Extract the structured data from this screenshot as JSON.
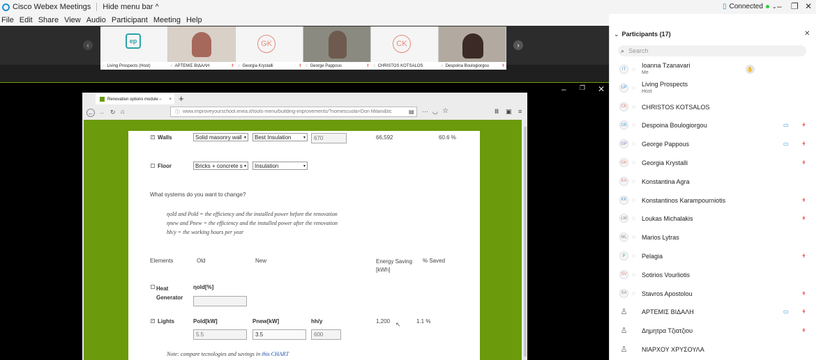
{
  "app": {
    "title": "Cisco Webex Meetings",
    "hide_menu": "Hide menu bar ^",
    "status": "Connected"
  },
  "menu": [
    "File",
    "Edit",
    "Share",
    "View",
    "Audio",
    "Participant",
    "Meeting",
    "Help"
  ],
  "tiles": [
    {
      "label": "Living Prospects (Host)",
      "kind": "logo",
      "logo": "ep"
    },
    {
      "label": "ΑΡΤΕΜΙΣ ΒΙΔΑΛΗ",
      "kind": "video"
    },
    {
      "label": "Georgia Krystalli",
      "kind": "initials",
      "initials": "GK"
    },
    {
      "label": "George Pappous",
      "kind": "video"
    },
    {
      "label": "CHRISTOS KOTSALOS",
      "kind": "initials",
      "initials": "CK"
    },
    {
      "label": "Despoina Boulogiorgou",
      "kind": "video"
    }
  ],
  "browser": {
    "tab": "Renovation options module –",
    "url": "www.improveyourschool.enea.it/tools-menu/building-improvements/?nomescuola=Don Milani&tic"
  },
  "doc": {
    "walls_label": "Walls",
    "walls_sel1": "Solid masonry wall",
    "walls_sel2": "Best Insulation",
    "walls_input": "670",
    "walls_saving": "66,592",
    "walls_pct": "60.6 %",
    "floor_label": "Floor",
    "floor_sel1": "Bricks + concrete s",
    "floor_sel2": "Insulation",
    "question": "What systems do you want to change?",
    "def1": "ηold and Pold = the efficiency and the installed power before the renovation",
    "def2": "ηnew and Pnew = the efficiency and the installed power after the renovation",
    "def3": "hh/y = the working hours per year",
    "h_elements": "Elements",
    "h_old": "Old",
    "h_new": "New",
    "h_saving": "Energy Saving [kWh]",
    "h_pct": "% Saved",
    "heat_label": "Heat Generator",
    "heat_eta": "ηold[%]",
    "lights_label": "Lights",
    "p_old": "Pold[kW]",
    "p_new": "Pnew[kW]",
    "hhy": "hh/y",
    "lights_saving": "1,200",
    "lights_pct": "1.1 %",
    "in_old": "5.5",
    "in_new": "3.5",
    "in_hh": "600",
    "note": "Note: compare tecnologies and savings in",
    "note_link": "this CHART"
  },
  "panel": {
    "title": "Participants (17)",
    "search_placeholder": "Search",
    "participants": [
      {
        "initials": "IT",
        "name": "Ioanna Tzanavari",
        "sub": "Me",
        "video": false,
        "muted": false,
        "color": "#5a9bd5"
      },
      {
        "initials": "LP",
        "name": "Living Prospects",
        "sub": "Host",
        "video": false,
        "muted": false,
        "color": "#2a8fd6"
      },
      {
        "initials": "CK",
        "name": "CHRISTOS KOTSALOS",
        "sub": "",
        "video": false,
        "muted": false,
        "color": "#e57f6d"
      },
      {
        "initials": "DB",
        "name": "Despoina Boulogiorgou",
        "sub": "",
        "video": true,
        "muted": true,
        "color": "#5aa9d5"
      },
      {
        "initials": "GP",
        "name": "George Pappous",
        "sub": "",
        "video": true,
        "muted": true,
        "color": "#9a6fc0"
      },
      {
        "initials": "GK",
        "name": "Georgia Krystalli",
        "sub": "",
        "video": false,
        "muted": true,
        "color": "#e57f6d"
      },
      {
        "initials": "KA",
        "name": "Konstantina Agra",
        "sub": "",
        "video": false,
        "muted": false,
        "color": "#e57f6d"
      },
      {
        "initials": "KK",
        "name": "Konstantinos Karampourniotis",
        "sub": "",
        "video": false,
        "muted": true,
        "color": "#5a9bd5"
      },
      {
        "initials": "LM",
        "name": "Loukas Michalakis",
        "sub": "",
        "video": false,
        "muted": true,
        "color": "#888888"
      },
      {
        "initials": "ML",
        "name": "Marios Lytras",
        "sub": "",
        "video": false,
        "muted": false,
        "color": "#888888"
      },
      {
        "initials": "P",
        "name": "Pelagia",
        "sub": "",
        "video": false,
        "muted": true,
        "color": "#4caf50"
      },
      {
        "initials": "SV",
        "name": "Sotirios Vourliotis",
        "sub": "",
        "video": false,
        "muted": false,
        "color": "#e57f6d"
      },
      {
        "initials": "SA",
        "name": "Stavros Apostolou",
        "sub": "",
        "video": false,
        "muted": true,
        "color": "#888888"
      },
      {
        "initials": "",
        "name": "ΑΡΤΕΜΙΣ ΒΙΔΑΛΗ",
        "sub": "",
        "video": true,
        "muted": true,
        "color": "#666666"
      },
      {
        "initials": "",
        "name": "Δημητρα Τζιατζιου",
        "sub": "",
        "video": false,
        "muted": true,
        "color": "#666666"
      },
      {
        "initials": "",
        "name": "ΝΙΑΡΧΟΥ ΧΡΥΣΟΥΛΑ",
        "sub": "",
        "video": false,
        "muted": false,
        "color": "#666666"
      }
    ]
  }
}
